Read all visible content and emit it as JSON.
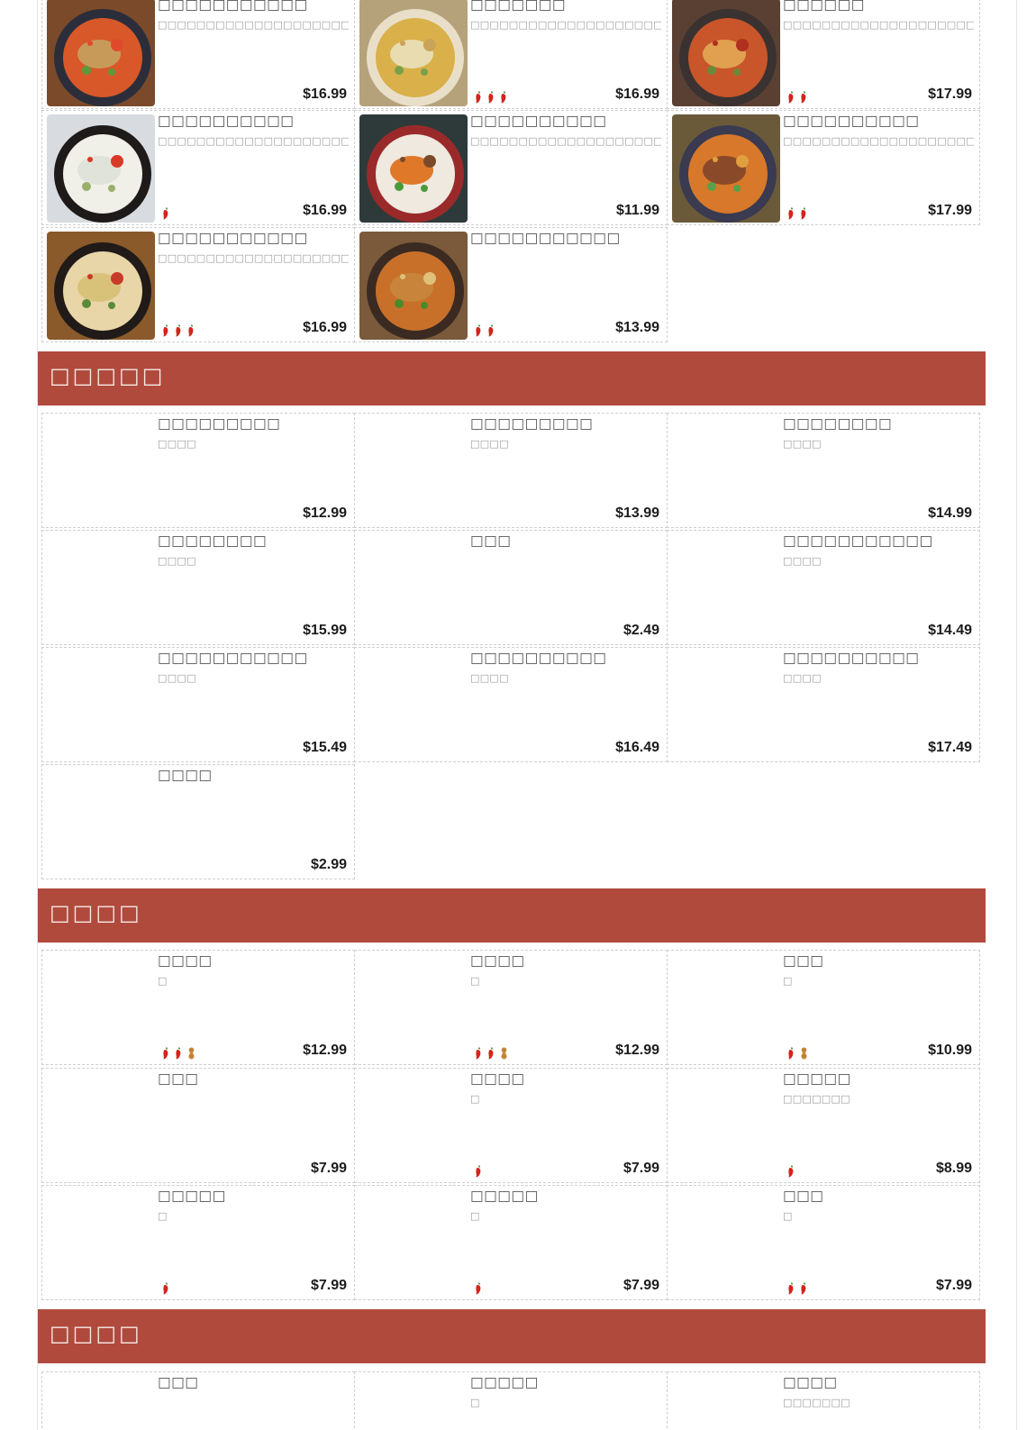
{
  "sections": [
    {
      "id": "top",
      "title": "",
      "items": [
        {
          "name": "□□□□□□□□□□□",
          "desc": "□□□□□□□□□□□□□□□□□□□□□□□□□□□□□□□□□□□",
          "price": "$16.99",
          "chili": 0,
          "peanut": false,
          "photo": "soup-red"
        },
        {
          "name": "□□□□□□□",
          "desc": "□□□□□□□□□□□□□□□□□□□□□□□□□□□□□□□□□□□",
          "price": "$16.99",
          "chili": 3,
          "peanut": false,
          "photo": "soup-gold"
        },
        {
          "name": "□□□□□□",
          "desc": "□□□□□□□□□□□□□□□□□□□□□□□□□□□□□□□□□□□□□□...",
          "price": "$17.99",
          "chili": 2,
          "peanut": false,
          "photo": "noodle-red"
        },
        {
          "name": "□□□□□□□□□□",
          "desc": "□□□□□□□□□□□□□□□□□□□□□□□□",
          "price": "$16.99",
          "chili": 1,
          "peanut": false,
          "photo": "soup-white"
        },
        {
          "name": "□□□□□□□□□□",
          "desc": "□□□□□□□□□□□□□□□□□□□□□□□□□□□□□□□□□",
          "price": "$11.99",
          "chili": 0,
          "peanut": false,
          "photo": "noodle-veg"
        },
        {
          "name": "□□□□□□□□□□",
          "desc": "□□□□□□□□□□□□□□□□□□□□□□□□□□□□□□□□□",
          "price": "$17.99",
          "chili": 2,
          "peanut": false,
          "photo": "soup-bokchoy"
        },
        {
          "name": "□□□□□□□□□□□",
          "desc": "□□□□□□□□□□□□□□□□□□□□□□□□□□□□□□□",
          "price": "$16.99",
          "chili": 3,
          "peanut": false,
          "photo": "soup-pot"
        },
        {
          "name": "□□□□□□□□□□□",
          "desc": "",
          "price": "$13.99",
          "chili": 2,
          "peanut": false,
          "photo": "noodle-crispy"
        }
      ]
    },
    {
      "id": "section-2",
      "title": "□□□□□",
      "items": [
        {
          "name": "□□□□□□□□□",
          "desc": "□□□□",
          "price": "$12.99",
          "chili": 0,
          "peanut": false
        },
        {
          "name": "□□□□□□□□□",
          "desc": "□□□□",
          "price": "$13.99",
          "chili": 0,
          "peanut": false
        },
        {
          "name": "□□□□□□□□",
          "desc": "□□□□",
          "price": "$14.99",
          "chili": 0,
          "peanut": false
        },
        {
          "name": "□□□□□□□□",
          "desc": "□□□□",
          "price": "$15.99",
          "chili": 0,
          "peanut": false
        },
        {
          "name": "□□□",
          "desc": "",
          "price": "$2.49",
          "chili": 0,
          "peanut": false
        },
        {
          "name": "□□□□□□□□□□□",
          "desc": "□□□□",
          "price": "$14.49",
          "chili": 0,
          "peanut": false
        },
        {
          "name": "□□□□□□□□□□□",
          "desc": "□□□□",
          "price": "$15.49",
          "chili": 0,
          "peanut": false
        },
        {
          "name": "□□□□□□□□□□",
          "desc": "□□□□",
          "price": "$16.49",
          "chili": 0,
          "peanut": false
        },
        {
          "name": "□□□□□□□□□□",
          "desc": "□□□□",
          "price": "$17.49",
          "chili": 0,
          "peanut": false
        },
        {
          "name": "□□□□",
          "desc": "",
          "price": "$2.99",
          "chili": 0,
          "peanut": false
        }
      ]
    },
    {
      "id": "section-3",
      "title": "□□□□",
      "items": [
        {
          "name": "□□□□",
          "desc": "□",
          "price": "$12.99",
          "chili": 2,
          "peanut": true
        },
        {
          "name": "□□□□",
          "desc": "□",
          "price": "$12.99",
          "chili": 2,
          "peanut": true
        },
        {
          "name": "□□□",
          "desc": "□",
          "price": "$10.99",
          "chili": 1,
          "peanut": true
        },
        {
          "name": "□□□",
          "desc": "",
          "price": "$7.99",
          "chili": 0,
          "peanut": false
        },
        {
          "name": "□□□□",
          "desc": "□",
          "price": "$7.99",
          "chili": 1,
          "peanut": false
        },
        {
          "name": "□□□□□",
          "desc": "□□□□□□□",
          "price": "$8.99",
          "chili": 1,
          "peanut": false
        },
        {
          "name": "□□□□□",
          "desc": "□",
          "price": "$7.99",
          "chili": 1,
          "peanut": false
        },
        {
          "name": "□□□□□",
          "desc": "□",
          "price": "$7.99",
          "chili": 1,
          "peanut": false
        },
        {
          "name": "□□□",
          "desc": "□",
          "price": "$7.99",
          "chili": 2,
          "peanut": false
        }
      ]
    },
    {
      "id": "section-4",
      "title": "□□□□",
      "items": [
        {
          "name": "□□□",
          "desc": "",
          "price": "",
          "chili": 0,
          "peanut": false
        },
        {
          "name": "□□□□□",
          "desc": "□",
          "price": "",
          "chili": 0,
          "peanut": false
        },
        {
          "name": "□□□□",
          "desc": "□□□□□□□",
          "price": "",
          "chili": 0,
          "peanut": false
        }
      ]
    }
  ],
  "colors": {
    "band": "#b04a3d",
    "band_text": "#f6e9e6",
    "chili": "#d4241c",
    "peanut": "#c98a3a",
    "price": "#1c1c1c"
  }
}
